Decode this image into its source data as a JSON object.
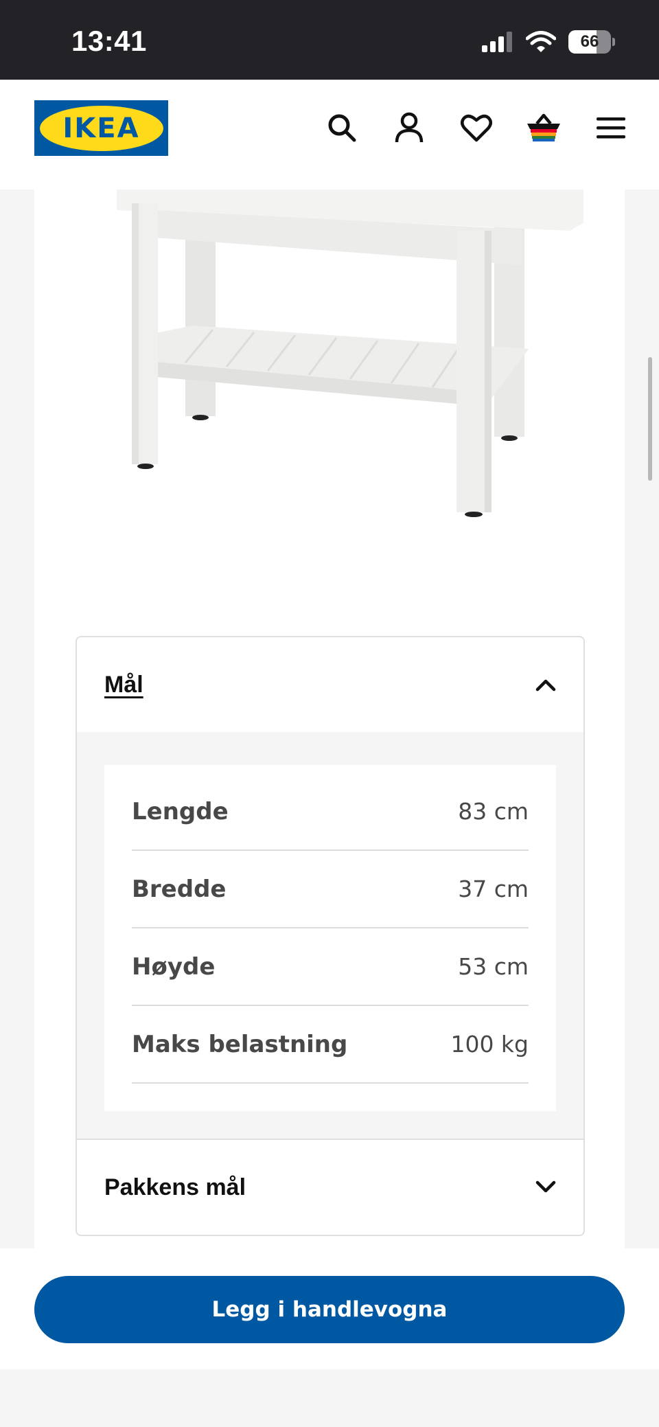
{
  "status_bar": {
    "time": "13:41",
    "battery": "66"
  },
  "header": {
    "logo_text": "IKEA",
    "icons": [
      "search-icon",
      "user-icon",
      "heart-icon",
      "basket-icon",
      "menu-icon"
    ]
  },
  "dimensions_section": {
    "title": "Mål",
    "expanded": true,
    "rows": [
      {
        "label": "Lengde",
        "value": "83 cm"
      },
      {
        "label": "Bredde",
        "value": "37 cm"
      },
      {
        "label": "Høyde",
        "value": "53 cm"
      },
      {
        "label": "Maks belastning",
        "value": "100 kg"
      }
    ]
  },
  "package_section": {
    "title": "Pakkens mål",
    "expanded": false
  },
  "cart_button": {
    "label": "Legg i handlevogna"
  },
  "colors": {
    "brand_blue": "#0058a3",
    "brand_yellow": "#ffda1a",
    "status_bar": "#222227"
  }
}
